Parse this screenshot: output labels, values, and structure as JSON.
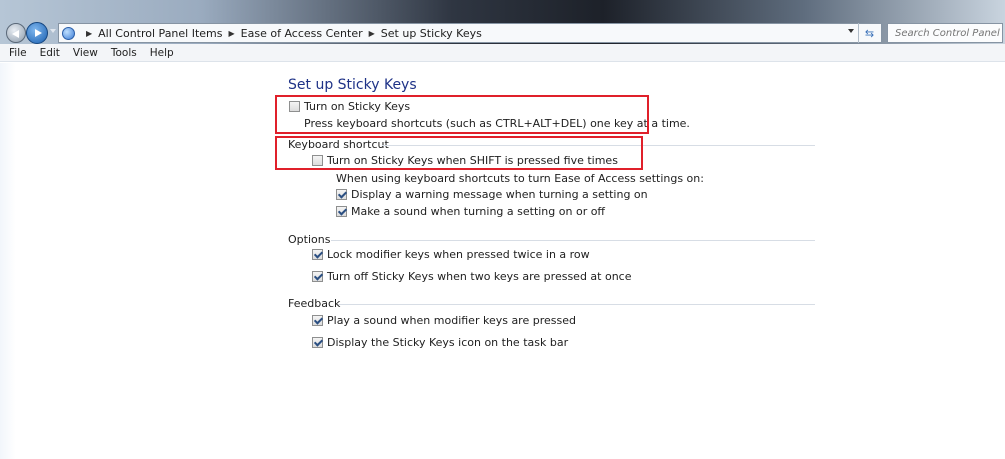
{
  "address_bar": {
    "crumbs": [
      "All Control Panel Items",
      "Ease of Access Center",
      "Set up Sticky Keys"
    ]
  },
  "search": {
    "placeholder": "Search Control Panel"
  },
  "menu": [
    "File",
    "Edit",
    "View",
    "Tools",
    "Help"
  ],
  "page": {
    "title": "Set up Sticky Keys"
  },
  "sticky_keys": {
    "turn_on": {
      "label": "Turn on Sticky Keys",
      "checked": false
    },
    "description": "Press keyboard shortcuts (such as CTRL+ALT+DEL) one key at a time."
  },
  "keyboard_shortcut": {
    "heading": "Keyboard shortcut",
    "shift_five": {
      "label": "Turn on Sticky Keys when SHIFT is pressed five times",
      "checked": false
    },
    "note": "When using keyboard shortcuts to turn Ease of Access settings on:",
    "warning": {
      "label": "Display a warning message when turning a setting on",
      "checked": true
    },
    "sound": {
      "label": "Make a sound when turning a setting on or off",
      "checked": true
    }
  },
  "options": {
    "heading": "Options",
    "lock_modifier": {
      "label": "Lock modifier keys when pressed twice in a row",
      "checked": true
    },
    "turn_off_two": {
      "label": "Turn off Sticky Keys when two keys are pressed at once",
      "checked": true
    }
  },
  "feedback": {
    "heading": "Feedback",
    "play_sound": {
      "label": "Play a sound when modifier keys are pressed",
      "checked": true
    },
    "taskbar_icon": {
      "label": "Display the Sticky Keys icon on the task bar",
      "checked": true
    }
  },
  "colors": {
    "title_blue": "#1e3287",
    "highlight_red": "#e0202a"
  }
}
